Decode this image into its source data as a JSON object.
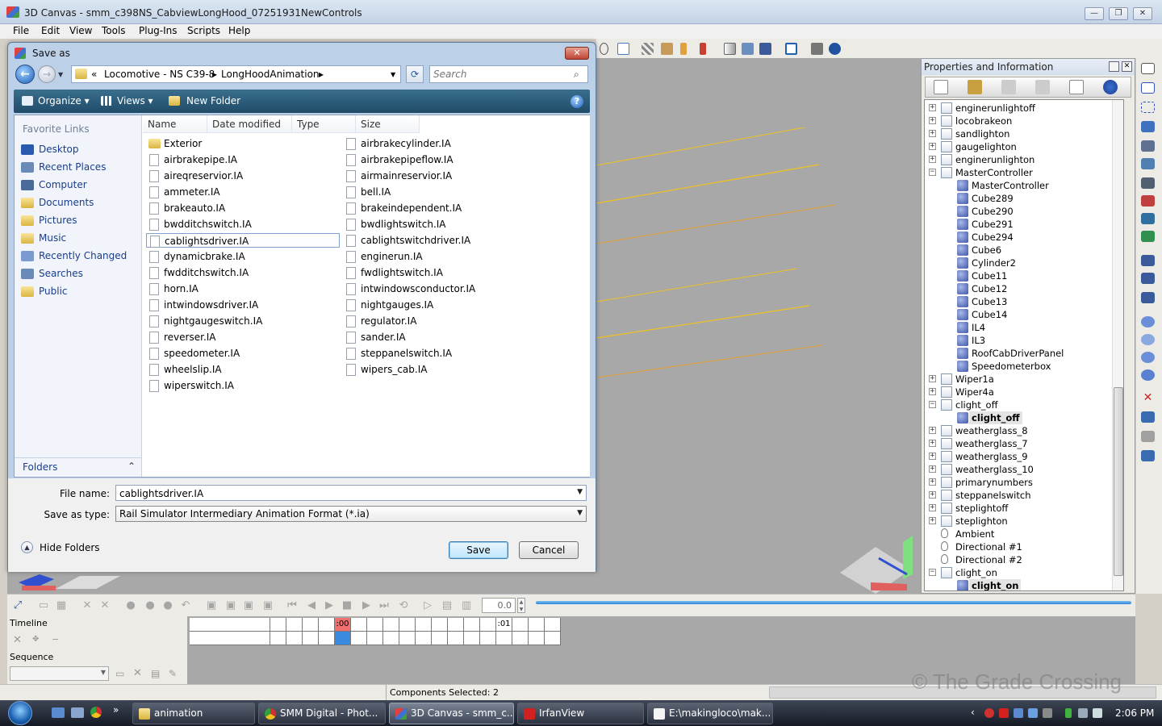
{
  "app": {
    "title": "3D Canvas - smm_c398NS_CabviewLongHood_07251931NewControls",
    "minimize": "—",
    "maximize": "❐",
    "close": "✕"
  },
  "menu": [
    "File",
    "Edit",
    "View",
    "Tools",
    "Plug-Ins",
    "Scripts",
    "Help"
  ],
  "dialog": {
    "title": "Save as",
    "close": "✕",
    "breadcrumb": [
      "«",
      "Locomotive - NS C39-8",
      "▸",
      "LongHoodAnimation",
      "▸"
    ],
    "search_placeholder": "Search",
    "commands": {
      "organize": "Organize ▾",
      "views": "Views ▾",
      "new_folder": "New Folder"
    },
    "favorite_links_heading": "Favorite Links",
    "favorites": [
      "Desktop",
      "Recent Places",
      "Computer",
      "Documents",
      "Pictures",
      "Music",
      "Recently Changed",
      "Searches",
      "Public"
    ],
    "folders_label": "Folders",
    "columns": [
      "Name",
      "Date modified",
      "Type",
      "Size"
    ],
    "files_col1": [
      "Exterior",
      "airbrakepipe.IA",
      "aireqreservior.IA",
      "ammeter.IA",
      "brakeauto.IA",
      "bwdditchswitch.IA",
      "cablightsdriver.IA",
      "dynamicbrake.IA",
      "fwdditchswitch.IA",
      "horn.IA",
      "intwindowsdriver.IA",
      "nightgaugeswitch.IA",
      "reverser.IA",
      "speedometer.IA",
      "wheelslip.IA",
      "wiperswitch.IA"
    ],
    "files_col2": [
      "airbrakecylinder.IA",
      "airbrakepipeflow.IA",
      "airmainreservior.IA",
      "bell.IA",
      "brakeindependent.IA",
      "bwdlightswitch.IA",
      "cablightswitchdriver.IA",
      "enginerun.IA",
      "fwdlightswitch.IA",
      "intwindowsconductor.IA",
      "nightgauges.IA",
      "regulator.IA",
      "sander.IA",
      "steppanelswitch.IA",
      "wipers_cab.IA"
    ],
    "selected_file": "cablightsdriver.IA",
    "file_name_label": "File name:",
    "file_name_value": "cablightsdriver.IA",
    "save_type_label": "Save as type:",
    "save_type_value": "Rail Simulator Intermediary Animation Format (*.ia)",
    "hide_folders": "Hide Folders",
    "save": "Save",
    "cancel": "Cancel"
  },
  "properties": {
    "title": "Properties and Information",
    "tree": [
      {
        "label": "enginerunlightoff",
        "level": 0,
        "exp": "+",
        "icon": "group"
      },
      {
        "label": "locobrakeon",
        "level": 0,
        "exp": "+",
        "icon": "group"
      },
      {
        "label": "sandlighton",
        "level": 0,
        "exp": "+",
        "icon": "group"
      },
      {
        "label": "gaugelighton",
        "level": 0,
        "exp": "+",
        "icon": "group"
      },
      {
        "label": "enginerunlighton",
        "level": 0,
        "exp": "+",
        "icon": "group"
      },
      {
        "label": "MasterController",
        "level": 0,
        "exp": "−",
        "icon": "group"
      },
      {
        "label": "MasterController",
        "level": 1,
        "icon": "mesh"
      },
      {
        "label": "Cube289",
        "level": 1,
        "icon": "mesh"
      },
      {
        "label": "Cube290",
        "level": 1,
        "icon": "mesh"
      },
      {
        "label": "Cube291",
        "level": 1,
        "icon": "mesh"
      },
      {
        "label": "Cube294",
        "level": 1,
        "icon": "mesh"
      },
      {
        "label": "Cube6",
        "level": 1,
        "icon": "mesh"
      },
      {
        "label": "Cylinder2",
        "level": 1,
        "icon": "mesh"
      },
      {
        "label": "Cube11",
        "level": 1,
        "icon": "mesh"
      },
      {
        "label": "Cube12",
        "level": 1,
        "icon": "mesh"
      },
      {
        "label": "Cube13",
        "level": 1,
        "icon": "mesh"
      },
      {
        "label": "Cube14",
        "level": 1,
        "icon": "mesh"
      },
      {
        "label": "IL4",
        "level": 1,
        "icon": "mesh"
      },
      {
        "label": "IL3",
        "level": 1,
        "icon": "mesh"
      },
      {
        "label": "RoofCabDriverPanel",
        "level": 1,
        "icon": "mesh"
      },
      {
        "label": "Speedometerbox",
        "level": 1,
        "icon": "mesh"
      },
      {
        "label": "Wiper1a",
        "level": 0,
        "exp": "+",
        "icon": "group"
      },
      {
        "label": "Wiper4a",
        "level": 0,
        "exp": "+",
        "icon": "group"
      },
      {
        "label": "clight_off",
        "level": 0,
        "exp": "−",
        "icon": "group"
      },
      {
        "label": "clight_off",
        "level": 1,
        "icon": "mesh",
        "bold": true
      },
      {
        "label": "weatherglass_8",
        "level": 0,
        "exp": "+",
        "icon": "group"
      },
      {
        "label": "weatherglass_7",
        "level": 0,
        "exp": "+",
        "icon": "group"
      },
      {
        "label": "weatherglass_9",
        "level": 0,
        "exp": "+",
        "icon": "group"
      },
      {
        "label": "weatherglass_10",
        "level": 0,
        "exp": "+",
        "icon": "group"
      },
      {
        "label": "primarynumbers",
        "level": 0,
        "exp": "+",
        "icon": "group"
      },
      {
        "label": "steppanelswitch",
        "level": 0,
        "exp": "+",
        "icon": "group"
      },
      {
        "label": "steplightoff",
        "level": 0,
        "exp": "+",
        "icon": "group"
      },
      {
        "label": "steplighton",
        "level": 0,
        "exp": "+",
        "icon": "group"
      },
      {
        "label": "Ambient",
        "level": 0,
        "icon": "light"
      },
      {
        "label": "Directional #1",
        "level": 0,
        "icon": "light"
      },
      {
        "label": "Directional #2",
        "level": 0,
        "icon": "light"
      },
      {
        "label": "clight_on",
        "level": 0,
        "exp": "−",
        "icon": "group"
      },
      {
        "label": "clight_on",
        "level": 1,
        "icon": "mesh",
        "bold": true
      }
    ]
  },
  "animation": {
    "frame_value": "0.0",
    "timeline_label": "Timeline",
    "sequence_label": "Sequence",
    "frame_marks": [
      ":00",
      ":01"
    ]
  },
  "status": {
    "components_selected": "Components Selected: 2",
    "watermark": "© The Grade Crossing"
  },
  "taskbar": {
    "tasks": [
      "animation",
      "SMM Digital - Phot...",
      "3D Canvas - smm_c...",
      "IrfanView",
      "E:\\makingloco\\mak..."
    ],
    "clock": "2:06 PM"
  },
  "colors": {
    "accent": "#1f4b68",
    "viewport_bg": "#a8a8a8",
    "guide_lines": "#f0c020"
  }
}
